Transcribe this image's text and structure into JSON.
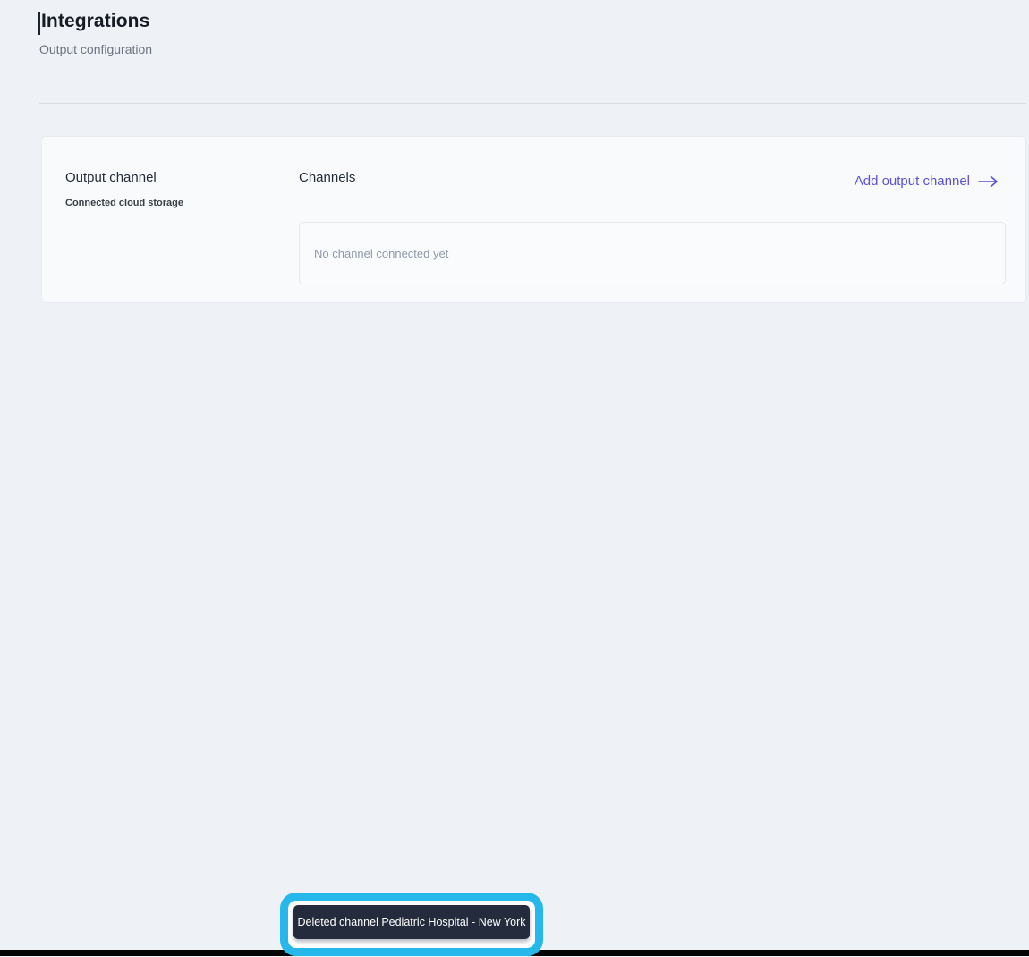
{
  "page": {
    "title": "Integrations",
    "subtitle": "Output configuration"
  },
  "card": {
    "section_title": "Output channel",
    "section_subtitle": "Connected cloud storage",
    "channels_label": "Channels",
    "add_channel_label": "Add output channel",
    "add_channel_icon": "arrow-right-icon",
    "empty_state": "No channel connected yet"
  },
  "toast": {
    "message": "Deleted channel Pediatric Hospital - New York"
  },
  "colors": {
    "page_background": "#eef1f6",
    "card_background": "#f8fafc",
    "accent_link": "#5b52d8",
    "toast_background": "#242b3c",
    "toast_text": "#ffffff",
    "annotation_highlight": "#26b8ea",
    "bottom_bar": "#050505"
  }
}
